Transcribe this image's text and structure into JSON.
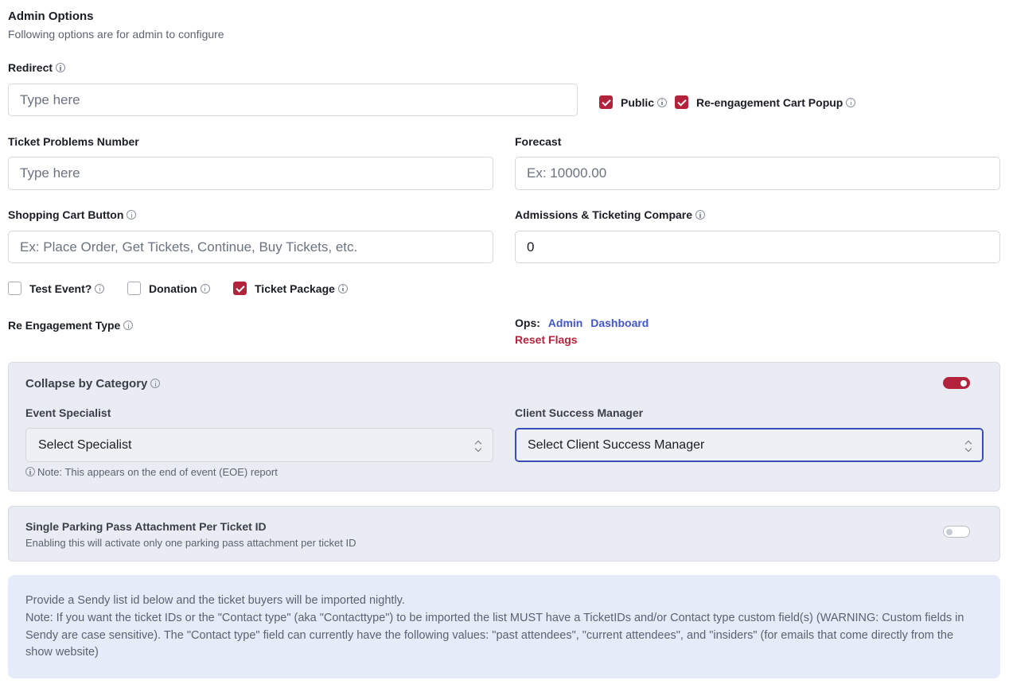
{
  "header": {
    "title": "Admin Options",
    "subtitle": "Following options are for admin to configure"
  },
  "redirect": {
    "label": "Redirect",
    "placeholder": "Type here"
  },
  "flags": {
    "public_label": "Public",
    "public_checked": true,
    "reengagement_label": "Re-engagement Cart Popup",
    "reengagement_checked": true
  },
  "ticket_problems": {
    "label": "Ticket Problems Number",
    "placeholder": "Type here"
  },
  "forecast": {
    "label": "Forecast",
    "placeholder": "Ex: 10000.00"
  },
  "shopping_cart": {
    "label": "Shopping Cart Button",
    "placeholder": "Ex: Place Order, Get Tickets, Continue, Buy Tickets, etc."
  },
  "admissions_compare": {
    "label": "Admissions & Ticketing Compare",
    "value": "0"
  },
  "options": {
    "test_event_label": "Test Event?",
    "test_event_checked": false,
    "donation_label": "Donation",
    "donation_checked": false,
    "ticket_package_label": "Ticket Package",
    "ticket_package_checked": true
  },
  "reengagement_type": {
    "label": "Re Engagement Type"
  },
  "ops": {
    "label": "Ops:",
    "admin_link": "Admin",
    "dashboard_link": "Dashboard",
    "reset_flags_link": "Reset Flags"
  },
  "collapse_panel": {
    "title": "Collapse by Category",
    "toggle_on": true,
    "event_specialist_label": "Event Specialist",
    "event_specialist_value": "Select Specialist",
    "csm_label": "Client Success Manager",
    "csm_value": "Select Client Success Manager",
    "note": "Note: This appears on the end of event (EOE) report"
  },
  "parking_panel": {
    "title": "Single Parking Pass Attachment Per Ticket ID",
    "description": "Enabling this will activate only one parking pass attachment per ticket ID",
    "toggle_on": false
  },
  "sendy_note": {
    "line1": "Provide a Sendy list id below and the ticket buyers will be imported nightly.",
    "line2": "Note: If you want the ticket IDs or the \"Contact type\" (aka \"Contacttype\") to be imported the list MUST have a TicketIDs and/or Contact type custom field(s) (WARNING: Custom fields in Sendy are case sensitive). The \"Contact type\" field can currently have the following values: \"past attendees\", \"current attendees\", and \"insiders\" (for emails that come directly from the show website)"
  },
  "colors": {
    "accent_red": "#b3243c",
    "link_blue": "#4255c9",
    "panel_bg": "#eaecf3",
    "note_bg": "#e5ebf8"
  }
}
